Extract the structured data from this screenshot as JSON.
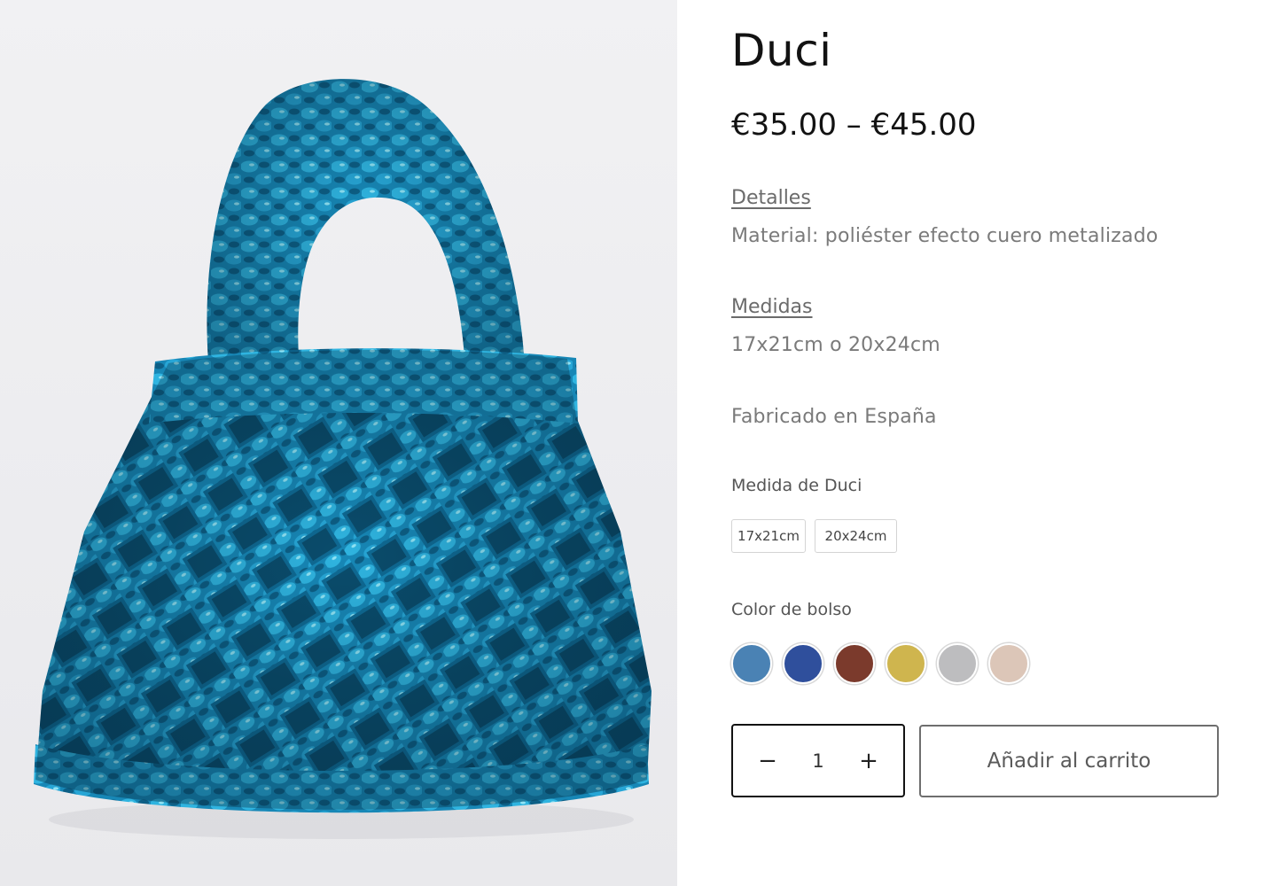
{
  "product": {
    "title": "Duci",
    "price": "€35.00 – €45.00",
    "image_alt": "Bolso de ganchillo azul metalizado"
  },
  "details": {
    "heading": "Detalles",
    "text": "Material: poliéster efecto cuero metalizado"
  },
  "measures": {
    "heading": "Medidas",
    "text": "17x21cm o 20x24cm"
  },
  "origin": "Fabricado en España",
  "size_option": {
    "label": "Medida de Duci",
    "values": [
      "17x21cm",
      "20x24cm"
    ]
  },
  "color_option": {
    "label": "Color de bolso",
    "swatches": [
      {
        "name": "azul claro",
        "color": "#4a82b4"
      },
      {
        "name": "azul",
        "color": "#2f4f9c"
      },
      {
        "name": "marrón",
        "color": "#7b3a2c"
      },
      {
        "name": "dorado",
        "color": "#cfb54e"
      },
      {
        "name": "plata",
        "color": "#bdbdbf"
      },
      {
        "name": "beige",
        "color": "#dcc6b8"
      }
    ]
  },
  "quantity": {
    "minus": "−",
    "value": "1",
    "plus": "+"
  },
  "add_to_cart": "Añadir al carrito"
}
